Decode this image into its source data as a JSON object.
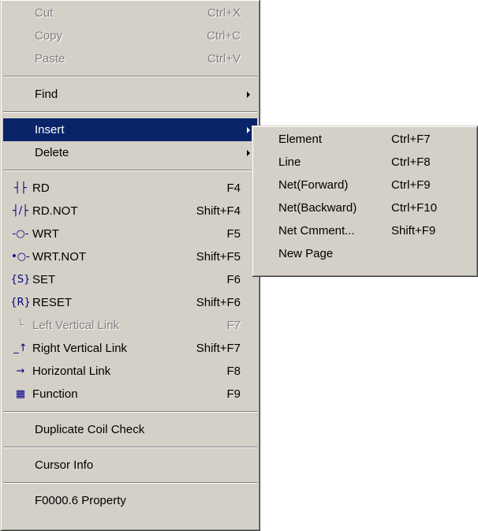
{
  "main_menu": {
    "edit": [
      {
        "label": "Cut",
        "shortcut": "Ctrl+X"
      },
      {
        "label": "Copy",
        "shortcut": "Ctrl+C"
      },
      {
        "label": "Paste",
        "shortcut": "Ctrl+V"
      }
    ],
    "find_label": "Find",
    "insert_label": "Insert",
    "delete_label": "Delete",
    "ladder": [
      {
        "icon": "contact-icon",
        "glyph": "┤├",
        "label": "RD",
        "shortcut": "F4"
      },
      {
        "icon": "contact-not-icon",
        "glyph": "┤/├",
        "label": "RD.NOT",
        "shortcut": "Shift+F4"
      },
      {
        "icon": "coil-icon",
        "glyph": "-○-",
        "label": "WRT",
        "shortcut": "F5"
      },
      {
        "icon": "coil-not-icon",
        "glyph": "•○-",
        "label": "WRT.NOT",
        "shortcut": "Shift+F5"
      },
      {
        "icon": "set-coil-icon",
        "glyph": "{S}",
        "label": "SET",
        "shortcut": "F6"
      },
      {
        "icon": "reset-coil-icon",
        "glyph": "{R}",
        "label": "RESET",
        "shortcut": "Shift+F6"
      },
      {
        "icon": "left-vertical-link-icon",
        "glyph": "└",
        "label": "Left Vertical Link",
        "shortcut": "F7"
      },
      {
        "icon": "right-vertical-link-icon",
        "glyph": "_↑",
        "label": "Right Vertical Link",
        "shortcut": "Shift+F7"
      },
      {
        "icon": "horizontal-link-icon",
        "glyph": "→",
        "label": "Horizontal Link",
        "shortcut": "F8"
      },
      {
        "icon": "function-block-icon",
        "glyph": "▦",
        "label": "Function",
        "shortcut": "F9"
      }
    ],
    "duplicate_coil_check_label": "Duplicate Coil Check",
    "cursor_info_label": "Cursor Info",
    "property_label": "F0000.6  Property"
  },
  "insert_submenu": [
    {
      "label": "Element",
      "shortcut": "Ctrl+F7"
    },
    {
      "label": "Line",
      "shortcut": "Ctrl+F8"
    },
    {
      "label": "Net(Forward)",
      "shortcut": "Ctrl+F9"
    },
    {
      "label": "Net(Backward)",
      "shortcut": "Ctrl+F10"
    },
    {
      "label": "Net Cmment...",
      "shortcut": "Shift+F9"
    },
    {
      "label": "New Page",
      "shortcut": ""
    }
  ],
  "colors": {
    "menu_bg": "#d4d0c8",
    "highlight": "#0a246a",
    "disabled_text": "#808080"
  }
}
